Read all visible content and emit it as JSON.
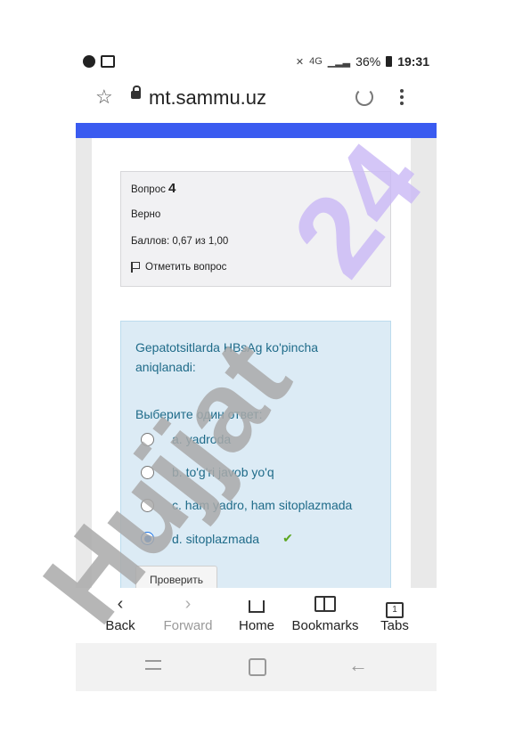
{
  "status_bar": {
    "battery": "36%",
    "time": "19:31",
    "network": "4G"
  },
  "browser": {
    "url": "mt.sammu.uz"
  },
  "question_info": {
    "label": "Вопрос",
    "number": "4",
    "state": "Верно",
    "score": "Баллов: 0,67 из 1,00",
    "flag_label": "Отметить вопрос"
  },
  "question": {
    "text": "Gepatotsitlarda HBsAg ko'pincha aniqlanadi:",
    "prompt": "Выберите один ответ:",
    "answers": [
      {
        "label": "a. yadroda",
        "checked": false
      },
      {
        "label": "b. to'g'ri javob yo'q",
        "checked": false
      },
      {
        "label": "c. ham yadro, ham sitoplazmada",
        "checked": false
      },
      {
        "label": "d. sitoplazmada",
        "checked": true,
        "correct_mark": "✔"
      }
    ],
    "check_button": "Проверить"
  },
  "bottom_nav": {
    "back": "Back",
    "forward": "Forward",
    "home": "Home",
    "bookmarks": "Bookmarks",
    "tabs": "Tabs",
    "tab_count": "1"
  },
  "watermark": {
    "text_gray": "Hujjat",
    "text_purple": "24",
    "color_gray": "#a9a9a9",
    "color_purple": "#c9b8f5"
  },
  "colors": {
    "accent_bar": "#3a5bf0",
    "question_text": "#1f6b89",
    "radio_checked": "#1a73e8",
    "correct_check": "#5aa51e"
  }
}
